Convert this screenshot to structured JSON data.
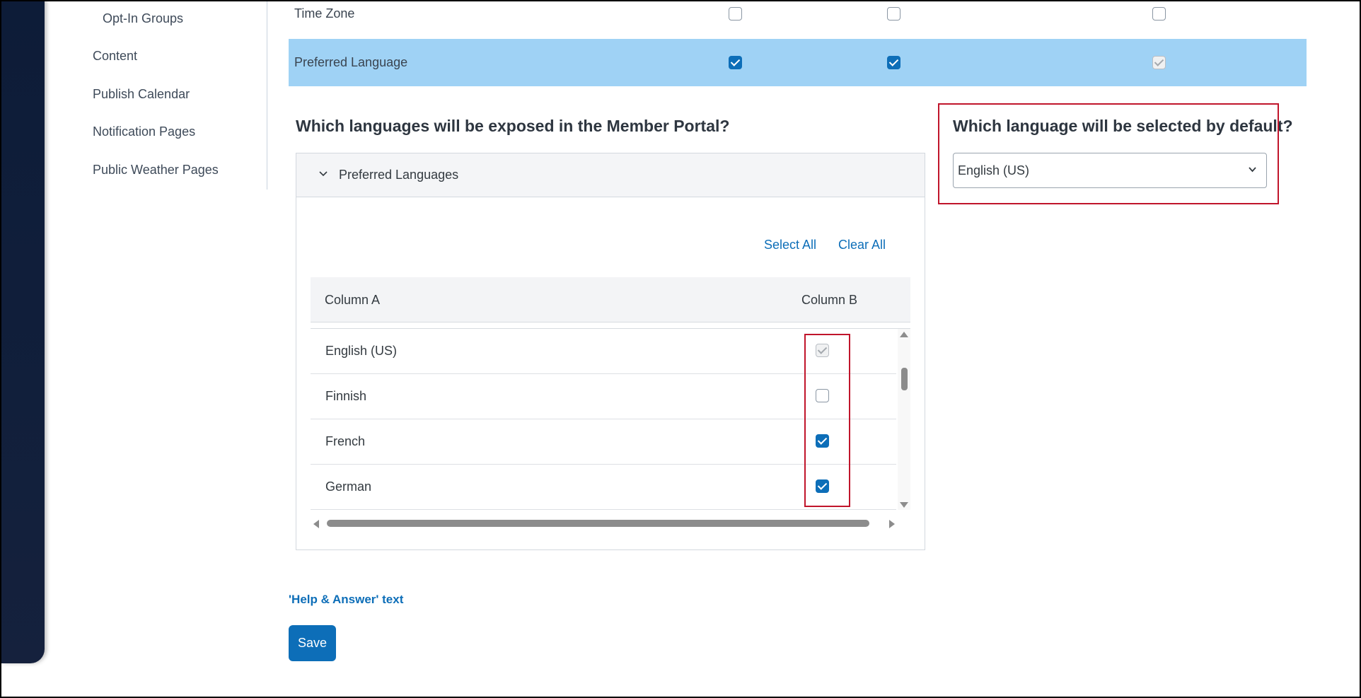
{
  "sidebar": {
    "items": [
      {
        "label": "Opt-In Groups"
      },
      {
        "label": "Content"
      },
      {
        "label": "Publish Calendar"
      },
      {
        "label": "Notification Pages"
      },
      {
        "label": "Public Weather Pages"
      }
    ]
  },
  "permissions": {
    "rows": [
      {
        "label": "Time Zone",
        "checks": [
          false,
          false,
          false
        ],
        "third_disabled": false
      },
      {
        "label": "Preferred Language",
        "checks": [
          true,
          true,
          true
        ],
        "third_disabled": true
      }
    ]
  },
  "languages_question": "Which languages will be exposed in the Member Portal?",
  "default_question": "Which language will be selected by default?",
  "panel": {
    "title": "Preferred Languages",
    "select_all": "Select All",
    "clear_all": "Clear All",
    "columns": [
      "Column A",
      "Column B"
    ],
    "rows": [
      {
        "language": "English (US)",
        "checked": true,
        "disabled": true
      },
      {
        "language": "Finnish",
        "checked": false,
        "disabled": false
      },
      {
        "language": "French",
        "checked": true,
        "disabled": false
      },
      {
        "language": "German",
        "checked": true,
        "disabled": false
      }
    ]
  },
  "default_select": {
    "value": "English (US)"
  },
  "help_link": "'Help & Answer' text",
  "save_label": "Save",
  "colors": {
    "accent": "#0d6eb8",
    "highlight_row": "#9fd2f5",
    "callout": "#c0152b"
  }
}
